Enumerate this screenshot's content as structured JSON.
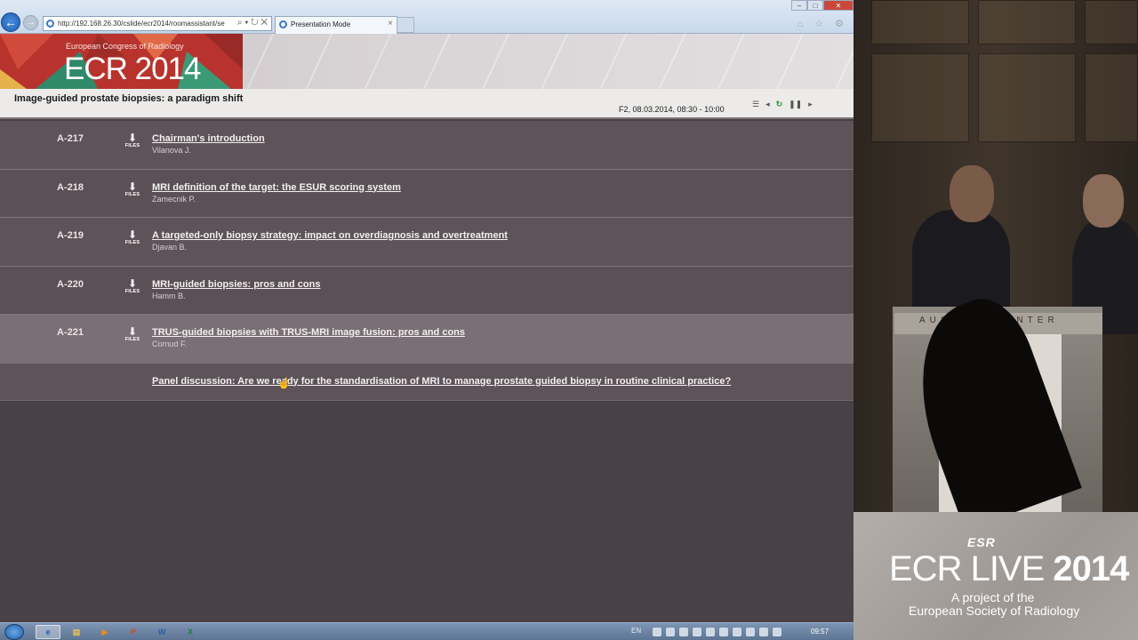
{
  "browser": {
    "address": "http://192.168.26.30/cslide/ecr2014/roomassistant/se",
    "address_tools": "⌕ ▾ ↻ ✕",
    "tab_title": "Presentation Mode",
    "back_glyph": "←",
    "forward_glyph": "→",
    "window_controls": {
      "minimize": "–",
      "maximize": "□",
      "close": "✕"
    },
    "right_icons": "⌂ ☆ ⚙"
  },
  "banner": {
    "subtitle": "European Congress of Radiology",
    "logo": "ECR 2014"
  },
  "session": {
    "title": "Image-guided prostate biopsies: a paradigm shift",
    "datetime": "F2, 08.03.2014, 08:30 - 10:00",
    "controls": [
      "☰",
      "◂",
      "↻",
      "❚❚",
      "▸"
    ]
  },
  "presentations": [
    {
      "code": "A-217",
      "title": "Chairman's introduction",
      "author": "Vilanova J.",
      "files_label": "FILES"
    },
    {
      "code": "A-218",
      "title": "MRI definition of the target: the ESUR scoring system",
      "author": "Zamecnik P.",
      "files_label": "FILES"
    },
    {
      "code": "A-219",
      "title": "A targeted-only biopsy strategy: impact on overdiagnosis and overtreatment",
      "author": "Djavan B.",
      "files_label": "FILES"
    },
    {
      "code": "A-220",
      "title": "MRI-guided biopsies: pros and cons",
      "author": "Hamm B.",
      "files_label": "FILES"
    },
    {
      "code": "A-221",
      "title": "TRUS-guided biopsies with TRUS-MRI image fusion: pros and cons",
      "author": "Cornud F.",
      "files_label": "FILES"
    }
  ],
  "panel_discussion": "Panel discussion: Are we ready for the standardisation of MRI to manage prostate guided biopsy in routine clinical practice?",
  "taskbar": {
    "language": "EN",
    "clock": "09:57",
    "apps": [
      "e",
      "▤",
      "▶",
      "P",
      "W",
      "X"
    ]
  },
  "video": {
    "podium_text": "AUSTRIA CENTER"
  },
  "branding": {
    "esr_logo": "ESR",
    "live_light": "ECR LIVE ",
    "live_bold": "2014",
    "line1": "A project of the",
    "line2": "European Society of Radiology"
  },
  "colors": {
    "list_bg": "#5e5359",
    "highlight_row": "#7a6f75",
    "logo_red": "#b8332d",
    "header_bg": "#ecebea"
  }
}
